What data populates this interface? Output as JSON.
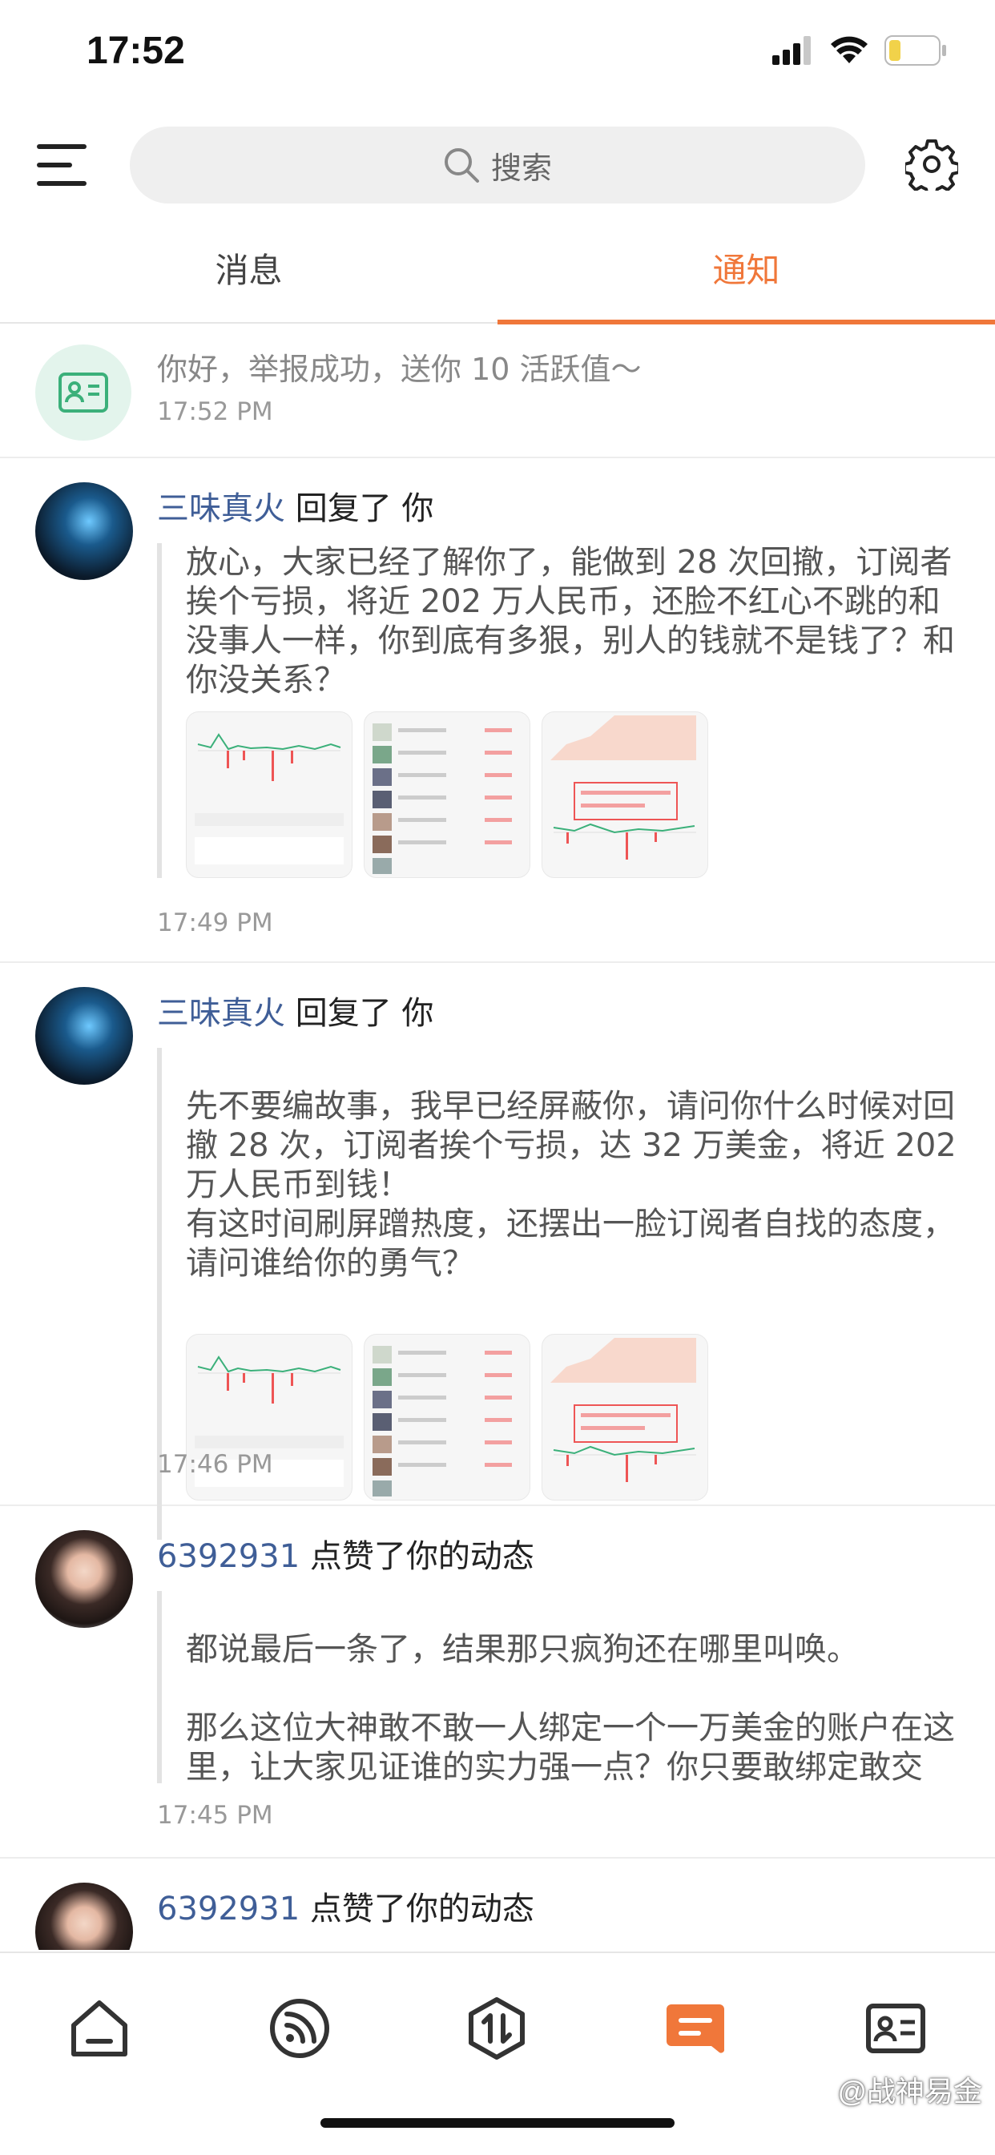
{
  "status": {
    "time": "17:52"
  },
  "search": {
    "placeholder": "搜索",
    "icon": "search-icon"
  },
  "tabs": [
    {
      "label": "消息",
      "active": false
    },
    {
      "label": "通知",
      "active": true
    }
  ],
  "accent_color": "#f0773a",
  "system_notice": {
    "icon": "id-card-icon",
    "text": "你好，举报成功，送你 10 活跃值～",
    "time": "17:52 PM"
  },
  "notifications": [
    {
      "user": "三味真火",
      "action": "回复了 你",
      "body": "放心，大家已经了解你了，能做到 28 次回撤，订阅者挨个亏损，将近 202 万人民币，还脸不红心不跳的和没事人一样，你到底有多狠，别人的钱就不是钱了？和你没关系？",
      "images": 3,
      "time": "17:49 PM"
    },
    {
      "user": "三味真火",
      "action": "回复了 你",
      "body": "先不要编故事，我早已经屏蔽你，请问你什么时候对回撤 28 次，订阅者挨个亏损，达 32 万美金，将近 202 万人民币到钱！\n有这时间刷屏蹭热度，还摆出一脸订阅者自找的态度，请问谁给你的勇气？",
      "images": 3,
      "time": "17:46 PM"
    },
    {
      "user": "6392931",
      "action": "点赞了你的动态",
      "body": "都说最后一条了，结果那只疯狗还在哪里叫唤。\n\n那么这位大神敢不敢一人绑定一个一万美金的账户在这里，让大家见证谁的实力强一点？你只要敢绑定敢交易，我要输了直接永远退出社区，你要输…",
      "time": "17:45 PM"
    },
    {
      "user": "6392931",
      "action": "点赞了你的动态"
    }
  ],
  "bottom_nav": [
    "home-icon",
    "feed-icon",
    "trade-icon",
    "notifications-icon",
    "profile-card-icon"
  ],
  "watermark": "@战神易金"
}
